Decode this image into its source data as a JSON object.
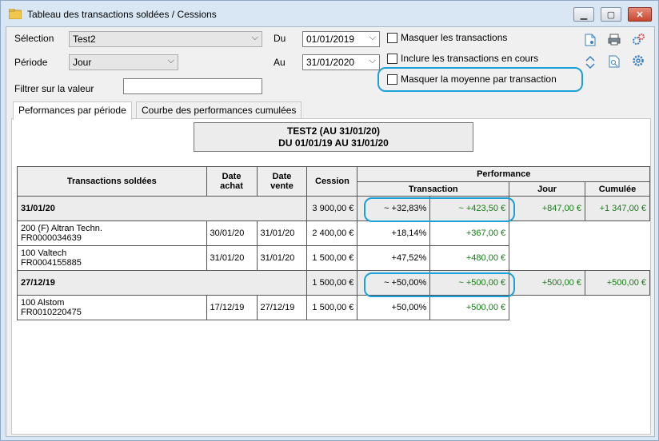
{
  "window": {
    "title": "Tableau des transactions soldées / Cessions"
  },
  "filters": {
    "selection_label": "Sélection",
    "selection_value": "Test2",
    "period_label": "Période",
    "period_value": "Jour",
    "from_label": "Du",
    "from_value": "01/01/2019",
    "to_label": "Au",
    "to_value": "31/01/2020",
    "value_filter_label": "Filtrer sur la valeur",
    "value_filter_value": ""
  },
  "options": {
    "hide_transactions": "Masquer les transactions",
    "include_pending": "Inclure les transactions en cours",
    "hide_average": "Masquer la moyenne par transaction"
  },
  "toolbar_icons": [
    "new-doc-icon",
    "print-icon",
    "settings-gears-icon",
    "sort-arrows-icon",
    "preview-doc-icon",
    "gear-icon"
  ],
  "tabs": [
    "Peformances par période",
    "Courbe des performances cumulées"
  ],
  "report": {
    "line1": "TEST2 (AU 31/01/20)",
    "line2": "DU 01/01/19 AU 31/01/20"
  },
  "table": {
    "headers": {
      "transactions": "Transactions soldées",
      "buy_date": "Date achat",
      "sell_date": "Date vente",
      "cession": "Cession",
      "performance": "Performance",
      "transaction": "Transaction",
      "day": "Jour",
      "cumulative": "Cumulée"
    },
    "groups": [
      {
        "label": "31/01/20",
        "cession": "3 900,00 €",
        "pct": "~ +32,83%",
        "amount": "~ +423,50 €",
        "day": "+847,00 €",
        "cumulative": "+1 347,00 €",
        "rows": [
          {
            "name": "200 (F) Altran Techn.",
            "code": "FR0000034639",
            "buy": "30/01/20",
            "sell": "31/01/20",
            "cession": "2 400,00 €",
            "pct": "+18,14%",
            "amount": "+367,00 €"
          },
          {
            "name": "100 Valtech",
            "code": "FR0004155885",
            "buy": "31/01/20",
            "sell": "31/01/20",
            "cession": "1 500,00 €",
            "pct": "+47,52%",
            "amount": "+480,00 €"
          }
        ]
      },
      {
        "label": "27/12/19",
        "cession": "1 500,00 €",
        "pct": "~ +50,00%",
        "amount": "~ +500,00 €",
        "day": "+500,00 €",
        "cumulative": "+500,00 €",
        "rows": [
          {
            "name": "100 Alstom",
            "code": "FR0010220475",
            "buy": "17/12/19",
            "sell": "27/12/19",
            "cession": "1 500,00 €",
            "pct": "+50,00%",
            "amount": "+500,00 €"
          }
        ]
      }
    ]
  }
}
